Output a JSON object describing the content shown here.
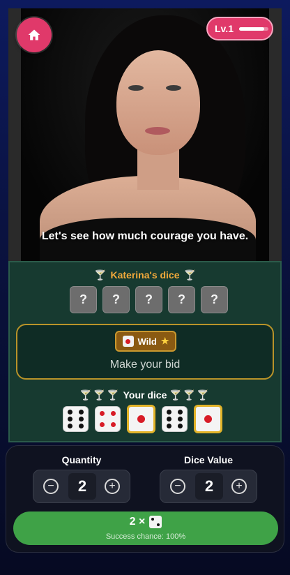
{
  "header": {
    "home_icon": "home-icon",
    "level_label": "Lv.1",
    "level_progress": 0.85
  },
  "portrait": {
    "caption": "Let's see how much courage you have."
  },
  "opponent": {
    "title": "Katerina's dice",
    "trophy_icon": "goblet-icon",
    "hidden_dice": [
      "?",
      "?",
      "?",
      "?",
      "?"
    ]
  },
  "bid": {
    "wild_label": "Wild",
    "wild_icon": "star-icon",
    "prompt": "Make your bid"
  },
  "player": {
    "title": "Your dice",
    "dice": [
      6,
      4,
      1,
      6,
      1
    ],
    "wild_value": 1
  },
  "controls": {
    "quantity_label": "Quantity",
    "quantity_value": "2",
    "dice_value_label": "Dice Value",
    "dice_value": "2",
    "bid_button_prefix": "2 ×",
    "bid_button_die": 2,
    "success_chance": "Success chance: 100%"
  },
  "colors": {
    "accent": "#e0396a",
    "table": "#173a30",
    "gold": "#b99329",
    "button": "#3fa247",
    "opponent_name": "#f2a93b"
  }
}
